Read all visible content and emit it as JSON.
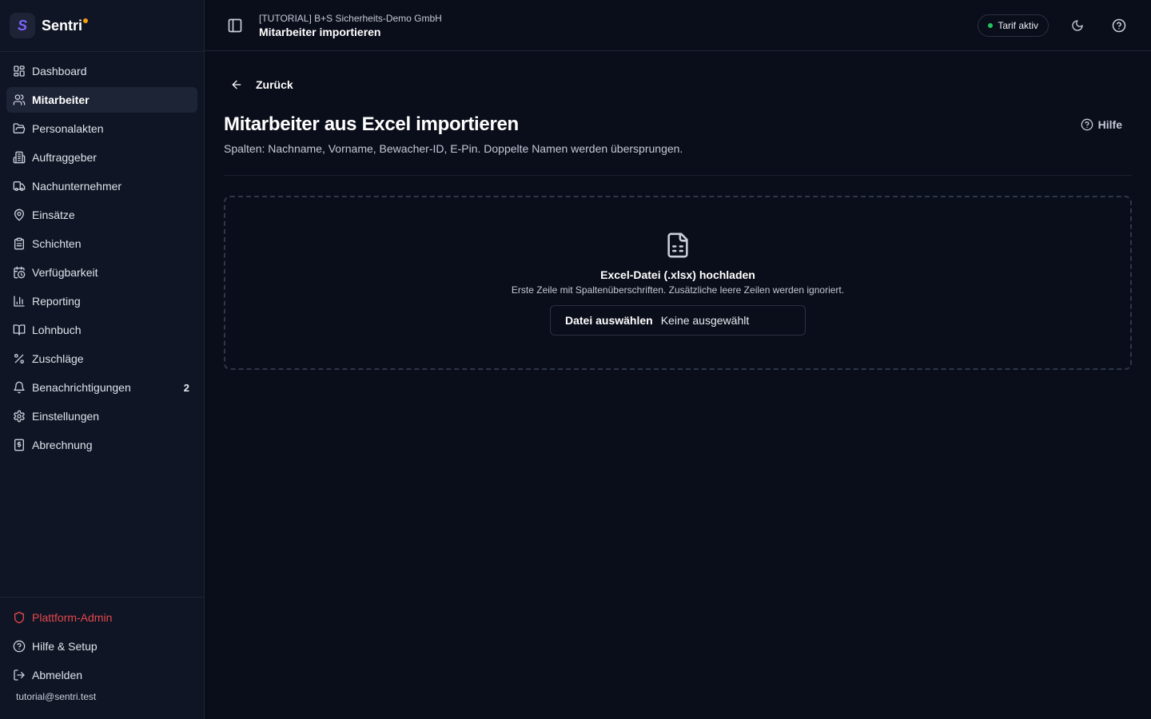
{
  "brand": {
    "logo_letter": "S",
    "name": "Sentri",
    "dot_color": "#f59e0b",
    "logo_color": "#7b63ff"
  },
  "sidebar": {
    "items": [
      {
        "label": "Dashboard",
        "icon": "dashboard-icon"
      },
      {
        "label": "Mitarbeiter",
        "icon": "users-icon",
        "active": true
      },
      {
        "label": "Personalakten",
        "icon": "folder-icon"
      },
      {
        "label": "Auftraggeber",
        "icon": "building-icon"
      },
      {
        "label": "Nachunternehmer",
        "icon": "truck-icon"
      },
      {
        "label": "Einsätze",
        "icon": "map-pin-icon"
      },
      {
        "label": "Schichten",
        "icon": "clipboard-icon"
      },
      {
        "label": "Verfügbarkeit",
        "icon": "calendar-clock-icon"
      },
      {
        "label": "Reporting",
        "icon": "bar-chart-icon"
      },
      {
        "label": "Lohnbuch",
        "icon": "book-icon"
      },
      {
        "label": "Zuschläge",
        "icon": "percent-icon"
      },
      {
        "label": "Benachrichtigungen",
        "icon": "bell-icon",
        "badge": "2"
      },
      {
        "label": "Einstellungen",
        "icon": "gear-icon"
      },
      {
        "label": "Abrechnung",
        "icon": "receipt-icon"
      }
    ],
    "bottom_items": [
      {
        "label": "Plattform-Admin",
        "icon": "shield-icon",
        "color": "#e5484d"
      },
      {
        "label": "Hilfe & Setup",
        "icon": "help-circle-icon"
      },
      {
        "label": "Abmelden",
        "icon": "logout-icon"
      }
    ],
    "user_email": "tutorial@sentri.test"
  },
  "topbar": {
    "org_name": "[TUTORIAL] B+S Sicherheits-Demo GmbH",
    "page_name": "Mitarbeiter importieren",
    "tarif_label": "Tarif aktiv",
    "tarif_dot_color": "#22c55e"
  },
  "main": {
    "back_label": "Zurück",
    "title": "Mitarbeiter aus Excel importieren",
    "subtitle": "Spalten: Nachname, Vorname, Bewacher-ID, E-Pin. Doppelte Namen werden übersprungen.",
    "help_label": "Hilfe",
    "upload": {
      "title": "Excel-Datei (.xlsx) hochladen",
      "hint": "Erste Zeile mit Spaltenüberschriften. Zusätzliche leere Zeilen werden ignoriert.",
      "button_label": "Datei auswählen",
      "file_status": "Keine ausgewählt"
    }
  }
}
